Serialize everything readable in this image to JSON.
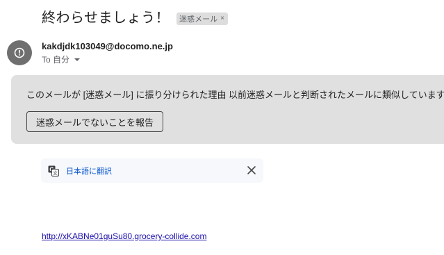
{
  "email": {
    "subject": "終わらせましょう！",
    "label_chip": {
      "label": "迷惑メール",
      "remove_glyph": "×"
    },
    "sender": {
      "email": "kakdjdk103049@docomo.ne.jp",
      "avatar_icon": "warning-icon",
      "recipient_label": "To 自分"
    },
    "spam_warning": {
      "message": "このメールが [迷惑メール] に振り分けられた理由 以前迷惑メールと判断されたメールに類似しています。",
      "report_button_label": "迷惑メールでないことを報告"
    },
    "translate_bar": {
      "icon": "translate-icon",
      "link_label": "日本語に翻訳",
      "close_icon": "close-icon"
    },
    "body": {
      "link_text": "http://xKABNe01guSu80.grocery-collide.com"
    }
  },
  "colors": {
    "warning_background": "#e0e0e0",
    "avatar_background": "#6f6f6f",
    "translate_link": "#0b57d0",
    "body_link": "#1a0dab",
    "translate_bar_background": "#f6f8fc"
  }
}
